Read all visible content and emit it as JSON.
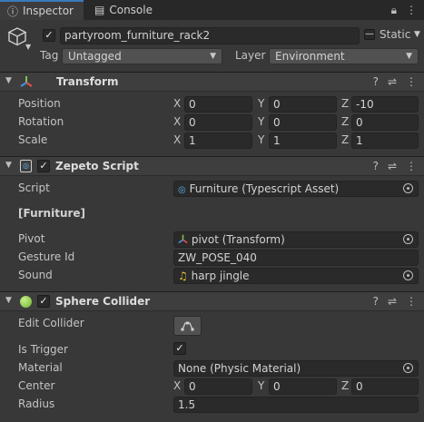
{
  "tabs": [
    {
      "label": "Inspector",
      "icon": "info-icon"
    },
    {
      "label": "Console",
      "icon": "console-icon"
    }
  ],
  "object": {
    "name": "partyroom_furniture_rack2",
    "active": true,
    "static_label": "Static",
    "tag_label": "Tag",
    "tag_value": "Untagged",
    "layer_label": "Layer",
    "layer_value": "Environment"
  },
  "transform": {
    "title": "Transform",
    "rows": [
      {
        "label": "Position",
        "x": "0",
        "y": "0",
        "z": "-10"
      },
      {
        "label": "Rotation",
        "x": "0",
        "y": "0",
        "z": "0"
      },
      {
        "label": "Scale",
        "x": "1",
        "y": "1",
        "z": "1"
      }
    ]
  },
  "axis": {
    "x": "X",
    "y": "Y",
    "z": "Z"
  },
  "zepeto": {
    "title": "Zepeto Script",
    "script_label": "Script",
    "script_value": "Furniture (Typescript Asset)",
    "group_header": "[Furniture]",
    "pivot_label": "Pivot",
    "pivot_value": "pivot (Transform)",
    "gesture_label": "Gesture Id",
    "gesture_value": "ZW_POSE_040",
    "sound_label": "Sound",
    "sound_value": "harp jingle"
  },
  "sphere": {
    "title": "Sphere Collider",
    "edit_label": "Edit Collider",
    "trigger_label": "Is Trigger",
    "trigger_checked": true,
    "material_label": "Material",
    "material_value": "None (Physic Material)",
    "center_label": "Center",
    "center": {
      "x": "0",
      "y": "0",
      "z": "0"
    },
    "radius_label": "Radius",
    "radius_value": "1.5"
  }
}
